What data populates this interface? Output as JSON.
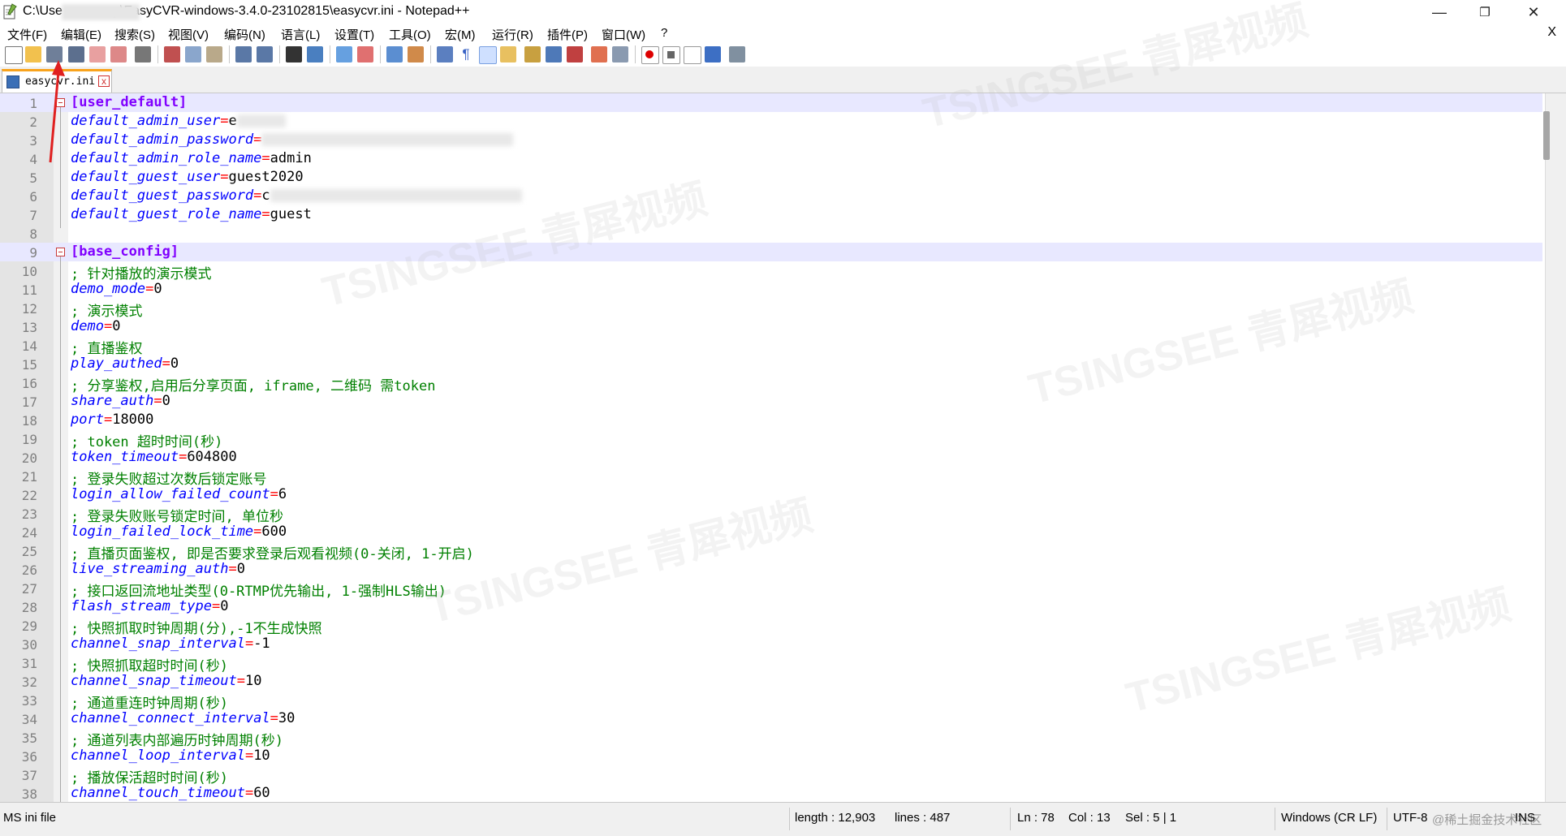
{
  "window": {
    "title": "C:\\Use            op\\EasyCVR-windows-3.4.0-23102815\\easycvr.ini - Notepad++",
    "minimize": "—",
    "maximize": "❐",
    "close": "✕"
  },
  "menu": {
    "items": [
      "文件(F)",
      "编辑(E)",
      "搜索(S)",
      "视图(V)",
      "编码(N)",
      "语言(L)",
      "设置(T)",
      "工具(O)",
      "宏(M)",
      "运行(R)",
      "插件(P)",
      "窗口(W)",
      "?"
    ],
    "close": "X"
  },
  "tab": {
    "label": "easycvr.ini",
    "close": "x"
  },
  "editor": {
    "lines": [
      {
        "n": "1",
        "type": "section",
        "text": "[user_default]"
      },
      {
        "n": "2",
        "type": "kv",
        "key": "default_admin_user",
        "value": "e",
        "redacted": true
      },
      {
        "n": "3",
        "type": "kv",
        "key": "default_admin_password",
        "value": "",
        "redacted": true
      },
      {
        "n": "4",
        "type": "kv",
        "key": "default_admin_role_name",
        "value": "admin"
      },
      {
        "n": "5",
        "type": "kv",
        "key": "default_guest_user",
        "value": "guest2020"
      },
      {
        "n": "6",
        "type": "kv",
        "key": "default_guest_password",
        "value": "c",
        "redacted": true
      },
      {
        "n": "7",
        "type": "kv",
        "key": "default_guest_role_name",
        "value": "guest"
      },
      {
        "n": "8",
        "type": "blank",
        "text": ""
      },
      {
        "n": "9",
        "type": "section",
        "text": "[base_config]"
      },
      {
        "n": "10",
        "type": "comment",
        "text": "; 针对播放的演示模式"
      },
      {
        "n": "11",
        "type": "kv",
        "key": "demo_mode",
        "value": "0"
      },
      {
        "n": "12",
        "type": "comment",
        "text": "; 演示模式"
      },
      {
        "n": "13",
        "type": "kv",
        "key": "demo",
        "value": "0"
      },
      {
        "n": "14",
        "type": "comment",
        "text": "; 直播鉴权"
      },
      {
        "n": "15",
        "type": "kv",
        "key": "play_authed",
        "value": "0"
      },
      {
        "n": "16",
        "type": "comment",
        "text": "; 分享鉴权,启用后分享页面, iframe, 二维码 需token"
      },
      {
        "n": "17",
        "type": "kv",
        "key": "share_auth",
        "value": "0"
      },
      {
        "n": "18",
        "type": "kv",
        "key": "port",
        "value": "18000"
      },
      {
        "n": "19",
        "type": "comment",
        "text": "; token 超时时间(秒)"
      },
      {
        "n": "20",
        "type": "kv",
        "key": "token_timeout",
        "value": "604800"
      },
      {
        "n": "21",
        "type": "comment",
        "text": "; 登录失败超过次数后锁定账号"
      },
      {
        "n": "22",
        "type": "kv",
        "key": "login_allow_failed_count",
        "value": "6"
      },
      {
        "n": "23",
        "type": "comment",
        "text": "; 登录失败账号锁定时间, 单位秒"
      },
      {
        "n": "24",
        "type": "kv",
        "key": "login_failed_lock_time",
        "value": "600"
      },
      {
        "n": "25",
        "type": "comment",
        "text": "; 直播页面鉴权, 即是否要求登录后观看视频(0-关闭, 1-开启)"
      },
      {
        "n": "26",
        "type": "kv",
        "key": "live_streaming_auth",
        "value": "0"
      },
      {
        "n": "27",
        "type": "comment",
        "text": "; 接口返回流地址类型(0-RTMP优先输出, 1-强制HLS输出)"
      },
      {
        "n": "28",
        "type": "kv",
        "key": "flash_stream_type",
        "value": "0"
      },
      {
        "n": "29",
        "type": "comment",
        "text": "; 快照抓取时钟周期(分),-1不生成快照"
      },
      {
        "n": "30",
        "type": "kv",
        "key": "channel_snap_interval",
        "value": "-1"
      },
      {
        "n": "31",
        "type": "comment",
        "text": "; 快照抓取超时时间(秒)"
      },
      {
        "n": "32",
        "type": "kv",
        "key": "channel_snap_timeout",
        "value": "10"
      },
      {
        "n": "33",
        "type": "comment",
        "text": "; 通道重连时钟周期(秒)"
      },
      {
        "n": "34",
        "type": "kv",
        "key": "channel_connect_interval",
        "value": "30"
      },
      {
        "n": "35",
        "type": "comment",
        "text": "; 通道列表内部遍历时钟周期(秒)"
      },
      {
        "n": "36",
        "type": "kv",
        "key": "channel_loop_interval",
        "value": "10"
      },
      {
        "n": "37",
        "type": "comment",
        "text": "; 播放保活超时时间(秒)"
      },
      {
        "n": "38",
        "type": "kv",
        "key": "channel_touch_timeout",
        "value": "60"
      }
    ]
  },
  "status": {
    "file_type": "MS ini file",
    "length": "length : 12,903",
    "lines": "lines : 487",
    "ln": "Ln : 78",
    "col": "Col : 13",
    "sel": "Sel : 5 | 1",
    "eol": "Windows (CR LF)",
    "encoding": "UTF-8",
    "mode": "INS",
    "credit": "@稀土掘金技术社区"
  },
  "watermark": "TSINGSEE 青犀视频"
}
